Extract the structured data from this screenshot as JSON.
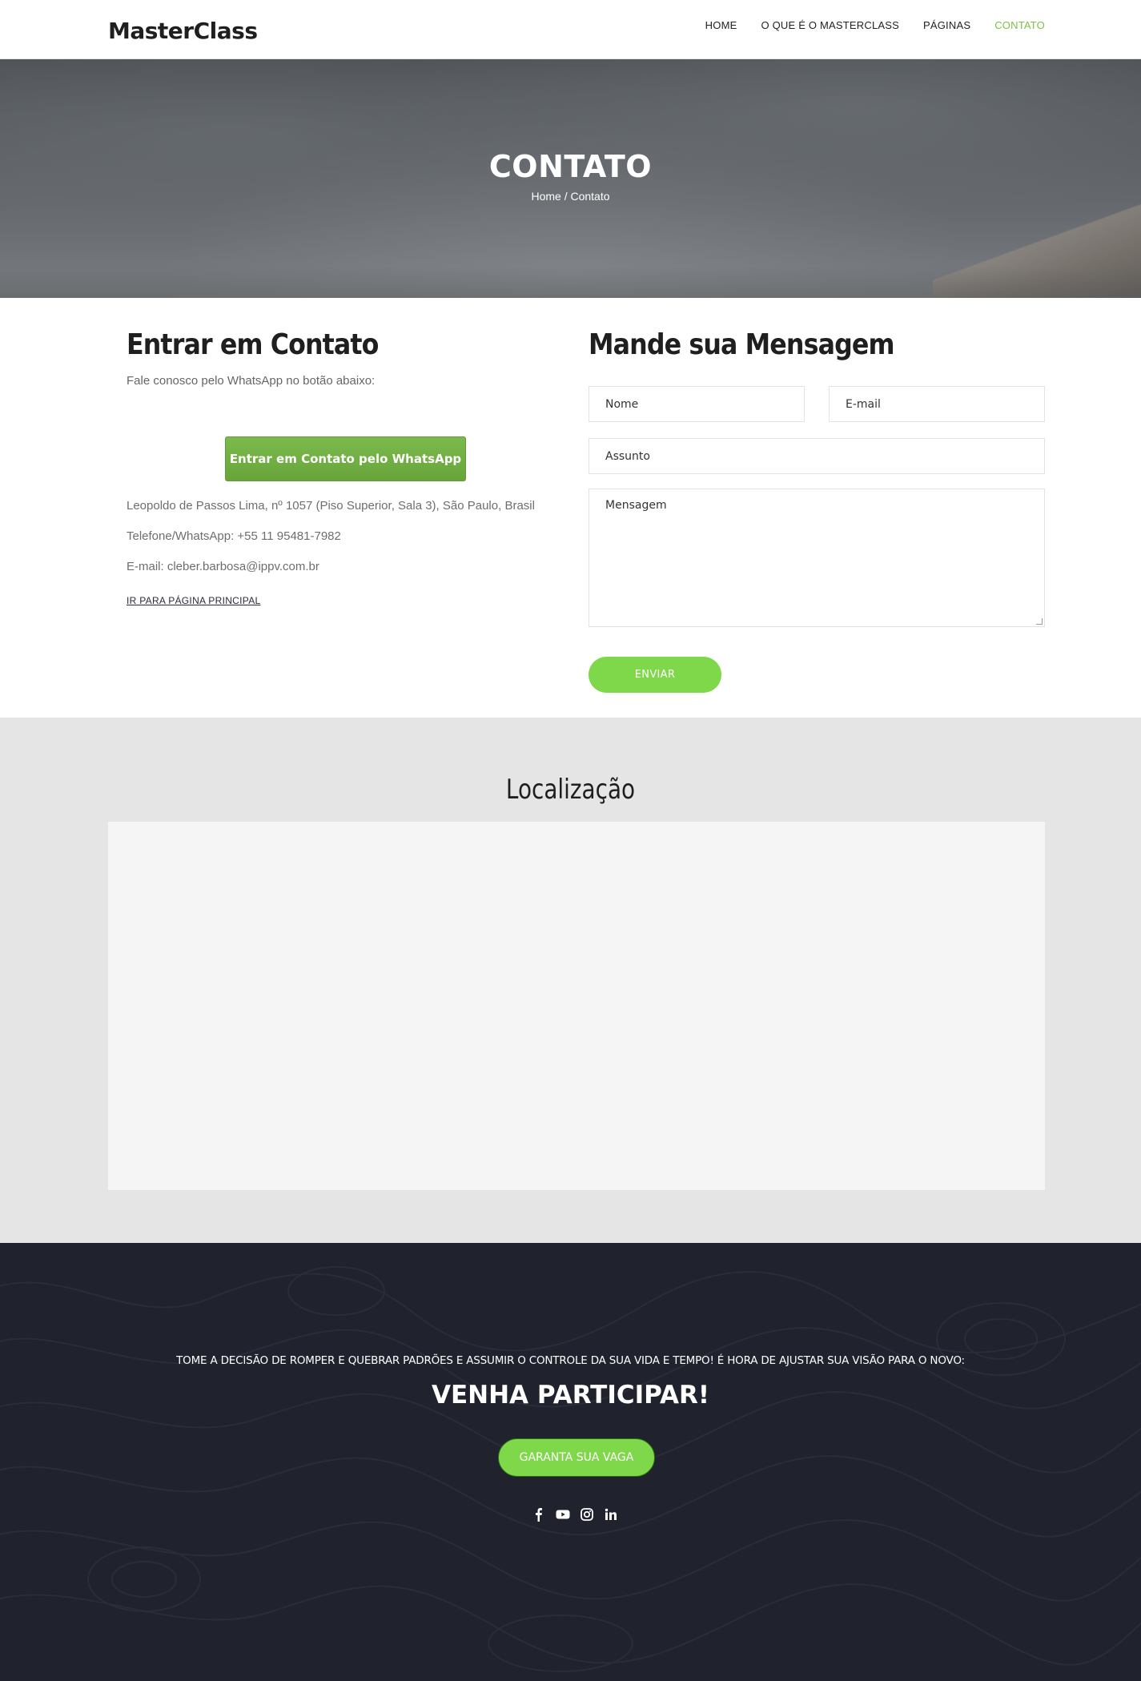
{
  "brand": "MasterClass",
  "nav": {
    "items": [
      {
        "label": "HOME"
      },
      {
        "label": "O QUE É O MASTERCLASS"
      },
      {
        "label": "PÁGINAS"
      },
      {
        "label": "CONTATO"
      }
    ]
  },
  "hero": {
    "title": "CONTATO",
    "breadcrumb_home": "Home",
    "breadcrumb_sep": "/",
    "breadcrumb_current": "Contato"
  },
  "contact": {
    "heading": "Entrar em Contato",
    "lead": "Fale conosco pelo WhatsApp no botão abaixo:",
    "whatsapp_button": "Entrar em Contato pelo WhatsApp",
    "address": "Leopoldo de Passos Lima, nº 1057 (Piso Superior, Sala 3), São Paulo, Brasil",
    "phone": "Telefone/WhatsApp: +55 11 95481-7982",
    "email": "E-mail: cleber.barbosa@ippv.com.br",
    "home_link": "IR PARA PÁGINA PRINCIPAL"
  },
  "form": {
    "heading": "Mande sua Mensagem",
    "name_placeholder": "Nome",
    "email_placeholder": "E-mail",
    "subject_placeholder": "Assunto",
    "message_placeholder": "Mensagem",
    "submit_label": "ENVIAR"
  },
  "location": {
    "title": "Localização"
  },
  "footer": {
    "tagline": "TOME A DECISÃO DE ROMPER E QUEBRAR PADRÕES E ASSUMIR O CONTROLE DA SUA VIDA E TEMPO! É HORA DE AJUSTAR SUA VISÃO PARA O NOVO:",
    "headline": "VENHA PARTICIPAR!",
    "cta_label": "GARANTA SUA VAGA",
    "social_icons": [
      "facebook-icon",
      "youtube-icon",
      "instagram-icon",
      "linkedin-icon"
    ]
  },
  "colors": {
    "accent": "#7fd84a",
    "nav_active": "#7cc242",
    "footer_bg": "#20222d",
    "map_section_bg": "#e5e5e5"
  }
}
